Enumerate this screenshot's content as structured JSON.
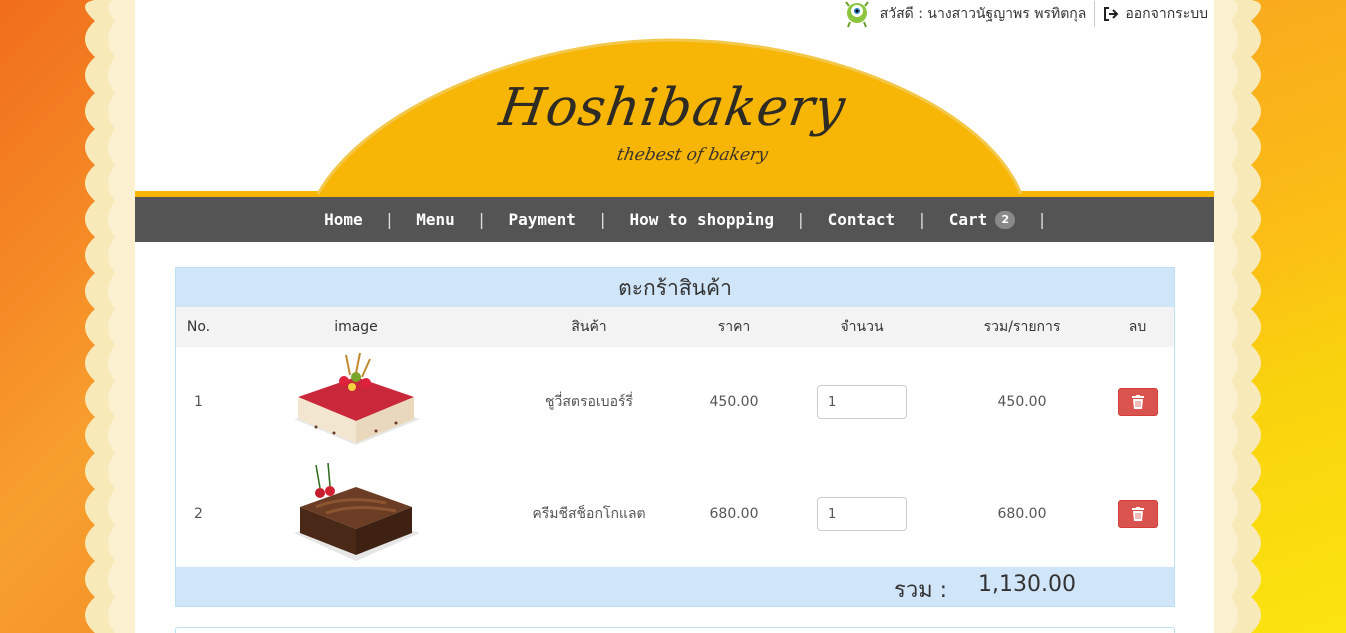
{
  "topbar": {
    "greeting": "สวัสดี : นางสาวนัฐญาพร พรทิตกุล",
    "logout_label": "ออกจากระบบ"
  },
  "logo": {
    "title": "Hoshibakery",
    "subtitle": "thebest of bakery"
  },
  "nav": {
    "items": [
      "Home",
      "Menu",
      "Payment",
      "How to shopping",
      "Contact",
      "Cart"
    ],
    "cart_count": "2"
  },
  "cart": {
    "title": "ตะกร้าสินค้า",
    "headers": [
      "No.",
      "image",
      "สินค้า",
      "ราคา",
      "จำนวน",
      "รวม/รายการ",
      "ลบ"
    ],
    "rows": [
      {
        "no": "1",
        "name": "ชูวี่สตรอเบอร์รี่",
        "price": "450.00",
        "qty": "1",
        "subtotal": "450.00"
      },
      {
        "no": "2",
        "name": "ครีมชีสช็อกโกแลต",
        "price": "680.00",
        "qty": "1",
        "subtotal": "680.00"
      }
    ],
    "total_label": "รวม :",
    "total_value": "1,130.00"
  },
  "colors": {
    "nav_bg": "#545454",
    "header_yellow": "#f7b605",
    "table_header_blue": "#d1e5f9",
    "delete_red": "#d9534f"
  },
  "icons": [
    "trash-icon",
    "logout-icon",
    "avatar-icon"
  ]
}
